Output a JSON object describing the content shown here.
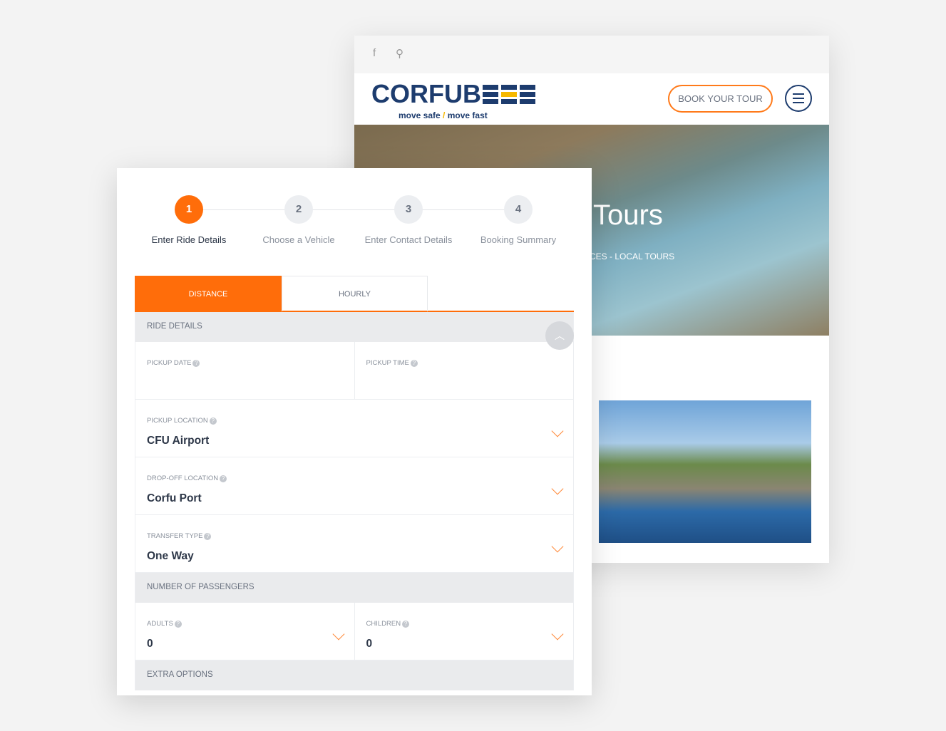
{
  "site": {
    "facebook_icon": "facebook-icon",
    "search_icon": "search-icon",
    "logo": "CORFUBEE",
    "tagline_a": "move safe",
    "tagline_sep": "/",
    "tagline_b": "move fast",
    "book_label": "BOOK YOUR TOUR",
    "hero_title": "Tours",
    "hero_crumb": "CES - LOCAL TOURS"
  },
  "steps": [
    {
      "num": "1",
      "label": "Enter Ride Details"
    },
    {
      "num": "2",
      "label": "Choose a Vehicle"
    },
    {
      "num": "3",
      "label": "Enter Contact Details"
    },
    {
      "num": "4",
      "label": "Booking Summary"
    }
  ],
  "tabs": {
    "distance": "DISTANCE",
    "hourly": "HOURLY"
  },
  "form": {
    "ride_details": "RIDE DETAILS",
    "pickup_date": {
      "label": "PICKUP DATE",
      "value": ""
    },
    "pickup_time": {
      "label": "PICKUP TIME",
      "value": ""
    },
    "pickup_location": {
      "label": "PICKUP LOCATION",
      "value": "CFU Airport"
    },
    "dropoff_location": {
      "label": "DROP-OFF LOCATION",
      "value": "Corfu Port"
    },
    "transfer_type": {
      "label": "TRANSFER TYPE",
      "value": "One Way"
    },
    "passengers": "NUMBER OF PASSENGERS",
    "adults": {
      "label": "ADULTS",
      "value": "0"
    },
    "children": {
      "label": "CHILDREN",
      "value": "0"
    },
    "extra_options": "EXTRA OPTIONS"
  },
  "colors": {
    "accent": "#ff6d0a",
    "brand_blue": "#1d3c6e",
    "brand_yellow": "#f6b800"
  }
}
